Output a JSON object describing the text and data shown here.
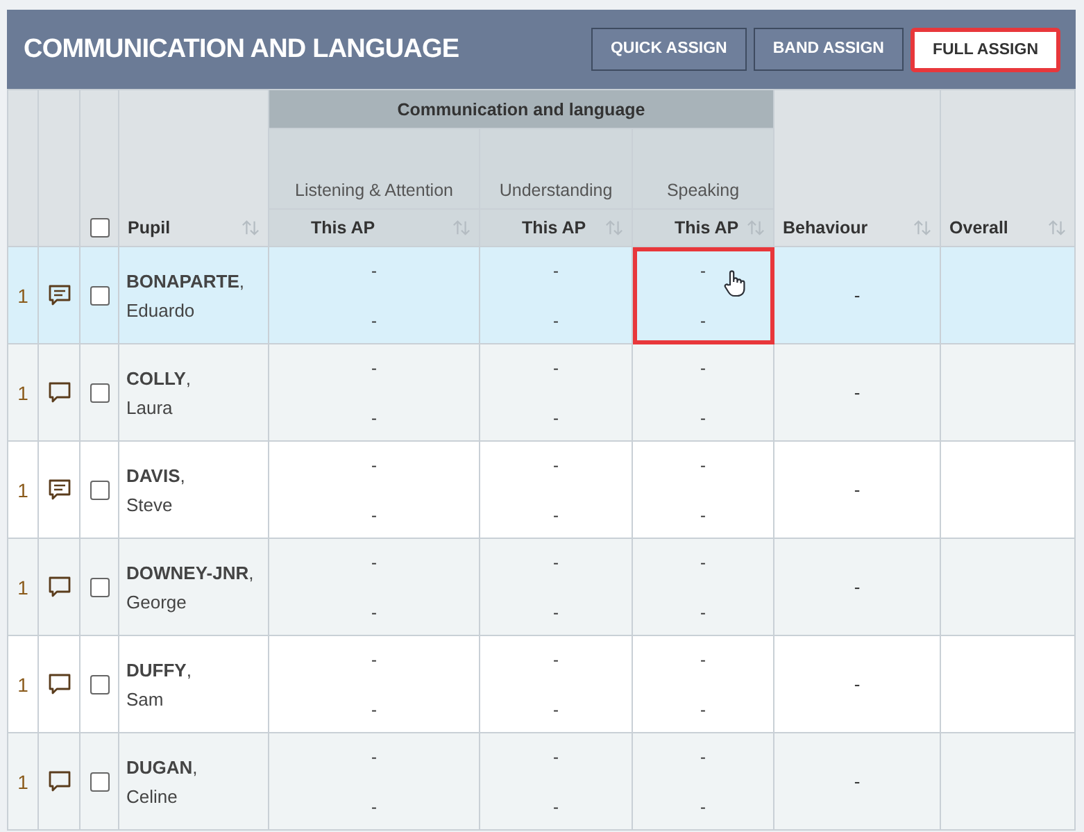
{
  "title": "COMMUNICATION AND LANGUAGE",
  "buttons": [
    {
      "label": "QUICK ASSIGN",
      "highlighted": false
    },
    {
      "label": "BAND ASSIGN",
      "highlighted": false
    },
    {
      "label": "FULL ASSIGN",
      "highlighted": true
    }
  ],
  "table": {
    "select_all": {
      "checked": false
    },
    "pupil_heading": "Pupil",
    "group_heading": "Communication and language",
    "subjects": [
      {
        "label": "Listening & Attention",
        "subheading": "This AP"
      },
      {
        "label": "Understanding",
        "subheading": "This AP"
      },
      {
        "label": "Speaking",
        "subheading": "This AP"
      }
    ],
    "behaviour_heading": "Behaviour",
    "overall_heading": "Overall",
    "rows": [
      {
        "number": "1",
        "has_comment": true,
        "checked": false,
        "selected": true,
        "surname": "**BONAPARTE**,",
        "forename": "Eduardo",
        "cells": [
          {
            "top": "-",
            "bottom": "-",
            "highlighted": false,
            "pointer": false
          },
          {
            "top": "-",
            "bottom": "-",
            "highlighted": false,
            "pointer": false
          },
          {
            "top": "-",
            "bottom": "-",
            "highlighted": true,
            "pointer": true
          }
        ],
        "behaviour": "-"
      },
      {
        "number": "1",
        "has_comment": false,
        "checked": false,
        "selected": false,
        "surname": "**COLLY**,",
        "forename": "Laura",
        "cells": [
          {
            "top": "-",
            "bottom": "-",
            "highlighted": false,
            "pointer": false
          },
          {
            "top": "-",
            "bottom": "-",
            "highlighted": false,
            "pointer": false
          },
          {
            "top": "-",
            "bottom": "-",
            "highlighted": false,
            "pointer": false
          }
        ],
        "behaviour": "-"
      },
      {
        "number": "1",
        "has_comment": true,
        "checked": false,
        "selected": false,
        "surname": "**DAVIS**,",
        "forename": "Steve",
        "cells": [
          {
            "top": "-",
            "bottom": "-",
            "highlighted": false,
            "pointer": false
          },
          {
            "top": "-",
            "bottom": "-",
            "highlighted": false,
            "pointer": false
          },
          {
            "top": "-",
            "bottom": "-",
            "highlighted": false,
            "pointer": false
          }
        ],
        "behaviour": "-"
      },
      {
        "number": "1",
        "has_comment": false,
        "checked": false,
        "selected": false,
        "surname": "**DOWNEY-JNR**,",
        "forename": "George",
        "cells": [
          {
            "top": "-",
            "bottom": "-",
            "highlighted": false,
            "pointer": false
          },
          {
            "top": "-",
            "bottom": "-",
            "highlighted": false,
            "pointer": false
          },
          {
            "top": "-",
            "bottom": "-",
            "highlighted": false,
            "pointer": false
          }
        ],
        "behaviour": "-"
      },
      {
        "number": "1",
        "has_comment": false,
        "checked": false,
        "selected": false,
        "surname": "**DUFFY**,",
        "forename": "Sam",
        "cells": [
          {
            "top": "-",
            "bottom": "-",
            "highlighted": false,
            "pointer": false
          },
          {
            "top": "-",
            "bottom": "-",
            "highlighted": false,
            "pointer": false
          },
          {
            "top": "-",
            "bottom": "-",
            "highlighted": false,
            "pointer": false
          }
        ],
        "behaviour": "-"
      },
      {
        "number": "1",
        "has_comment": false,
        "checked": false,
        "selected": false,
        "surname": "**DUGAN**,",
        "forename": "Celine",
        "cells": [
          {
            "top": "-",
            "bottom": "-",
            "highlighted": false,
            "pointer": false
          },
          {
            "top": "-",
            "bottom": "-",
            "highlighted": false,
            "pointer": false
          },
          {
            "top": "-",
            "bottom": "-",
            "highlighted": false,
            "pointer": false
          }
        ],
        "behaviour": "-"
      }
    ]
  }
}
